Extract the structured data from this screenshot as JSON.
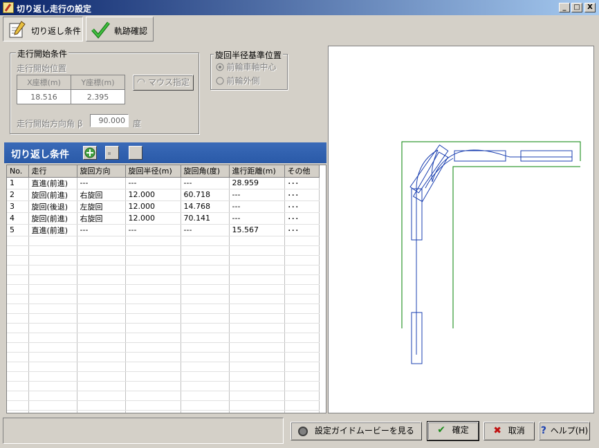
{
  "window": {
    "title": "切り返し走行の設定",
    "controls": [
      "_",
      "□",
      "X"
    ]
  },
  "tabs": [
    {
      "label": "切り返し条件",
      "icon": "notepad-pencil-icon",
      "active": true
    },
    {
      "label": "軌跡確認",
      "icon": "checkmark-icon",
      "active": false
    }
  ],
  "start_conditions": {
    "group_title": "走行開始条件",
    "position_label": "走行開始位置",
    "x_header": "X座標(m)",
    "y_header": "Y座標(m)",
    "x_value": "18.516",
    "y_value": "2.395",
    "mouse_button": "マウス指定",
    "angle_label": "走行開始方向角 β",
    "angle_value": "90.000",
    "angle_unit": "度"
  },
  "turn_reference": {
    "group_title": "旋回半径基準位置",
    "options": [
      "前輪車軸中心",
      "前輪外側"
    ],
    "selected": "前輪車軸中心"
  },
  "section": {
    "title": "切り返し条件",
    "buttons": [
      "add-row-icon",
      "insert-row-icon",
      "delete-row-icon"
    ]
  },
  "grid": {
    "columns": [
      "No.",
      "走行",
      "旋回方向",
      "旋回半径(m)",
      "旋回角(度)",
      "進行距離(m)",
      "その他"
    ],
    "rows": [
      [
        "1",
        "直進(前進)",
        "---",
        "---",
        "---",
        "28.959",
        "･･･"
      ],
      [
        "2",
        "旋回(前進)",
        "右旋回",
        "12.000",
        "60.718",
        "---",
        "･･･"
      ],
      [
        "3",
        "旋回(後退)",
        "左旋回",
        "12.000",
        "14.768",
        "---",
        "･･･"
      ],
      [
        "4",
        "旋回(前進)",
        "右旋回",
        "12.000",
        "70.141",
        "---",
        "･･･"
      ],
      [
        "5",
        "直進(前進)",
        "---",
        "---",
        "---",
        "15.567",
        "･･･"
      ]
    ]
  },
  "footer": {
    "guide_button": "設定ガイドムービーを見る",
    "ok_button": "確定",
    "cancel_button": "取消",
    "help_button": "ヘルプ(H)"
  },
  "colors": {
    "title_gradient_start": "#0a246a",
    "section_header": "#2a5aa8",
    "road_line": "#008000",
    "vehicle": "#1a3fb0"
  }
}
